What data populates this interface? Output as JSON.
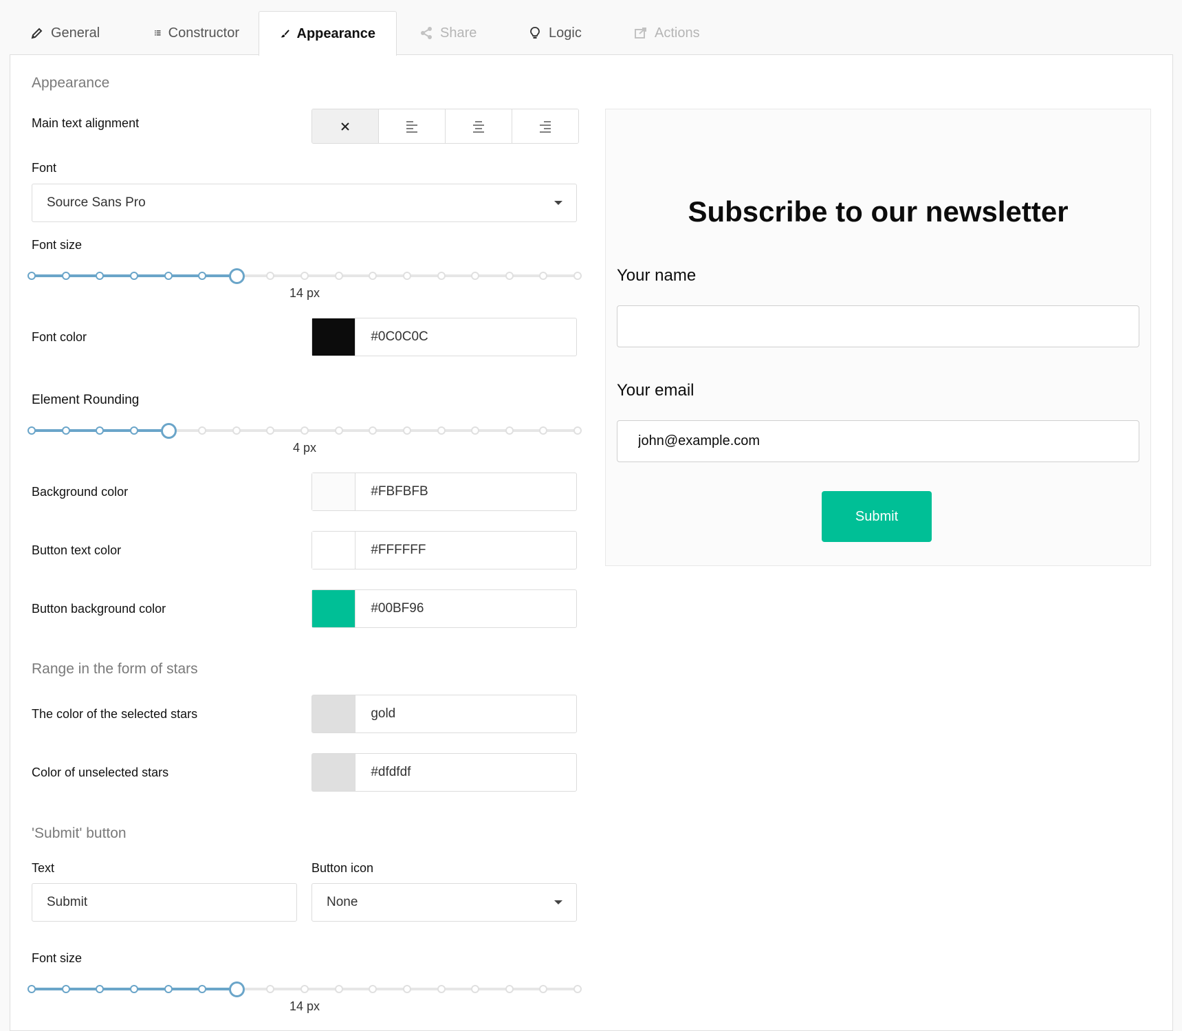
{
  "tabs": [
    {
      "label": "General",
      "icon": "pencil-icon",
      "state": "normal"
    },
    {
      "label": "Constructor",
      "icon": "list-icon",
      "state": "normal"
    },
    {
      "label": "Appearance",
      "icon": "brush-icon",
      "state": "active"
    },
    {
      "label": "Share",
      "icon": "share-icon",
      "state": "disabled"
    },
    {
      "label": "Logic",
      "icon": "lightbulb-icon",
      "state": "normal"
    },
    {
      "label": "Actions",
      "icon": "export-icon",
      "state": "disabled"
    }
  ],
  "appearance": {
    "section_title": "Appearance",
    "text_alignment": {
      "label": "Main text alignment",
      "options": [
        "none",
        "left",
        "center",
        "right"
      ],
      "selected": "none"
    },
    "font": {
      "label": "Font",
      "value": "Source Sans Pro"
    },
    "font_size": {
      "label": "Font size",
      "value_label": "14 px",
      "steps": 17,
      "selected_index": 6
    },
    "font_color": {
      "label": "Font color",
      "value": "#0C0C0C"
    },
    "element_rounding": {
      "label": "Element Rounding",
      "value_label": "4 px",
      "steps": 17,
      "selected_index": 4
    },
    "background_color": {
      "label": "Background color",
      "value": "#FBFBFB"
    },
    "button_text_color": {
      "label": "Button text color",
      "value": "#FFFFFF"
    },
    "button_bg_color": {
      "label": "Button background color",
      "value": "#00BF96"
    }
  },
  "stars": {
    "section_title": "Range in the form of stars",
    "selected": {
      "label": "The color of the selected stars",
      "value": "gold",
      "swatch": "#dfdfdf"
    },
    "unselected": {
      "label": "Color of unselected stars",
      "value": "#dfdfdf",
      "swatch": "#dfdfdf"
    }
  },
  "submit_button": {
    "section_title": "'Submit' button",
    "text_label": "Text",
    "text_value": "Submit",
    "icon_label": "Button icon",
    "icon_value": "None",
    "font_size_label": "Font size",
    "font_size_value": "14 px",
    "font_size_steps": 17,
    "font_size_selected_index": 6
  },
  "preview": {
    "title": "Subscribe to our newsletter",
    "name_label": "Your name",
    "name_value": "",
    "email_label": "Your email",
    "email_value": "john@example.com",
    "submit_label": "Submit"
  },
  "colors": {
    "accent": "#00BF96",
    "slider": "#6aa5c9"
  }
}
